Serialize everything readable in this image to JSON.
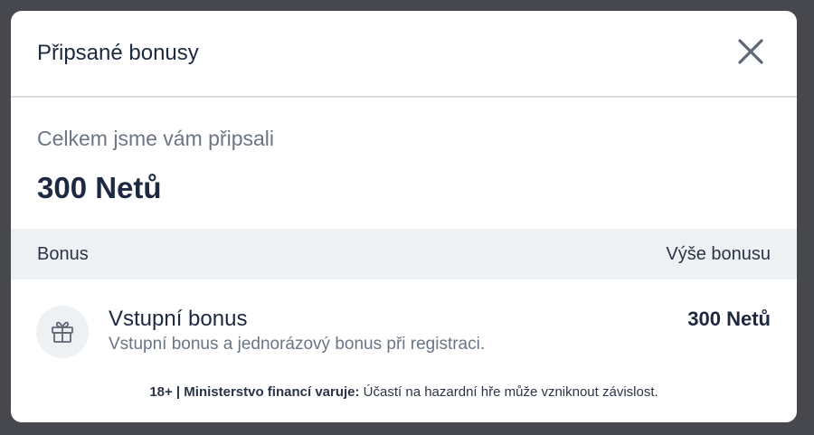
{
  "modal": {
    "title": "Připsané bonusy",
    "close_icon": "close-icon"
  },
  "summary": {
    "label": "Celkem jsme vám připsali",
    "total": "300 Netů"
  },
  "table": {
    "columns": [
      "Bonus",
      "Výše bonusu"
    ],
    "rows": [
      {
        "icon": "gift-icon",
        "title": "Vstupní bonus",
        "description": "Vstupní bonus a jednorázový bonus při registraci.",
        "amount": "300 Netů"
      }
    ]
  },
  "footer": {
    "warning_bold": "18+ | Ministerstvo financí varuje:",
    "warning_text": " Účastí na hazardní hře může vzniknout závislost."
  },
  "colors": {
    "heading": "#1d2940",
    "muted": "#6b7684",
    "table_header_bg": "#eef1f4",
    "overlay": "#2e3036"
  }
}
